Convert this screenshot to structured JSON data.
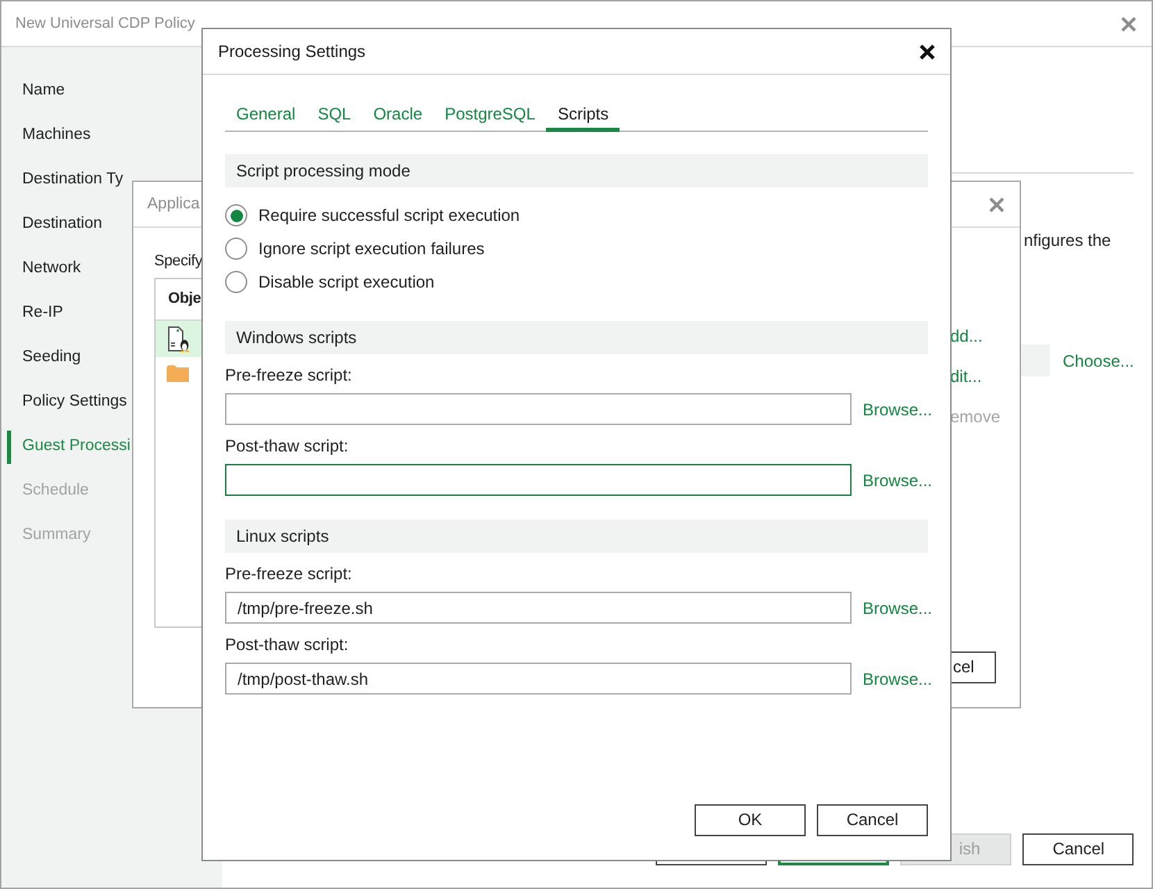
{
  "wizard": {
    "title": "New Universal CDP Policy",
    "active": false,
    "steps": [
      {
        "label": "Name",
        "selected": false,
        "disabled": false
      },
      {
        "label": "Machines",
        "selected": false,
        "disabled": false
      },
      {
        "label": "Destination Ty",
        "selected": false,
        "disabled": false
      },
      {
        "label": "Destination",
        "selected": false,
        "disabled": false
      },
      {
        "label": "Network",
        "selected": false,
        "disabled": false
      },
      {
        "label": "Re-IP",
        "selected": false,
        "disabled": false
      },
      {
        "label": "Seeding",
        "selected": false,
        "disabled": false
      },
      {
        "label": "Policy Settings",
        "selected": false,
        "disabled": false
      },
      {
        "label": "Guest Processi",
        "selected": true,
        "disabled": false
      },
      {
        "label": "Schedule",
        "selected": false,
        "disabled": true
      },
      {
        "label": "Summary",
        "selected": false,
        "disabled": true
      }
    ],
    "description": "nfigures the",
    "choose_link": "Choose...",
    "footer_buttons": [
      {
        "kind": "outline",
        "disabled": false
      },
      {
        "kind": "primary",
        "disabled": false
      },
      {
        "kind": "outline",
        "label": "ish",
        "disabled": true
      },
      {
        "kind": "outline",
        "label": "Cancel",
        "disabled": false
      }
    ]
  },
  "application_dialog": {
    "title": "Applica",
    "active": false,
    "instruction": "Specify",
    "list": {
      "columns": [
        "Obje"
      ],
      "rows": [
        {
          "kind": "linux-machine",
          "selected": true
        },
        {
          "kind": "folder",
          "selected": false
        }
      ]
    },
    "actions": [
      {
        "label": "dd...",
        "disabled": false
      },
      {
        "label": "dit...",
        "disabled": false
      },
      {
        "label": "emove",
        "disabled": true
      }
    ],
    "buttons": [
      "cel"
    ]
  },
  "processing_dialog": {
    "title": "Processing Settings",
    "active": true,
    "tabs": [
      {
        "label": "General",
        "selected": false
      },
      {
        "label": "SQL",
        "selected": false
      },
      {
        "label": "Oracle",
        "selected": false
      },
      {
        "label": "PostgreSQL",
        "selected": false
      },
      {
        "label": "Scripts",
        "selected": true
      }
    ],
    "sections": [
      {
        "kind": "radio-group",
        "title": "Script processing mode",
        "options": [
          {
            "label": "Require successful script execution",
            "selected": true
          },
          {
            "label": "Ignore script execution failures",
            "selected": false
          },
          {
            "label": "Disable script execution",
            "selected": false
          }
        ]
      },
      {
        "kind": "script-fields",
        "title": "Windows scripts",
        "fields": [
          {
            "label": "Pre-freeze script:",
            "focused": false,
            "browse": "Browse..."
          },
          {
            "label": "Post-thaw script:",
            "focused": true,
            "browse": "Browse..."
          }
        ]
      },
      {
        "kind": "script-fields",
        "title": "Linux scripts",
        "fields": [
          {
            "label": "Pre-freeze script:",
            "value": "/tmp/pre-freeze.sh",
            "focused": false,
            "browse": "Browse..."
          },
          {
            "label": "Post-thaw script:",
            "value": "/tmp/post-thaw.sh",
            "focused": false,
            "browse": "Browse..."
          }
        ]
      }
    ],
    "buttons": [
      "OK",
      "Cancel"
    ]
  }
}
